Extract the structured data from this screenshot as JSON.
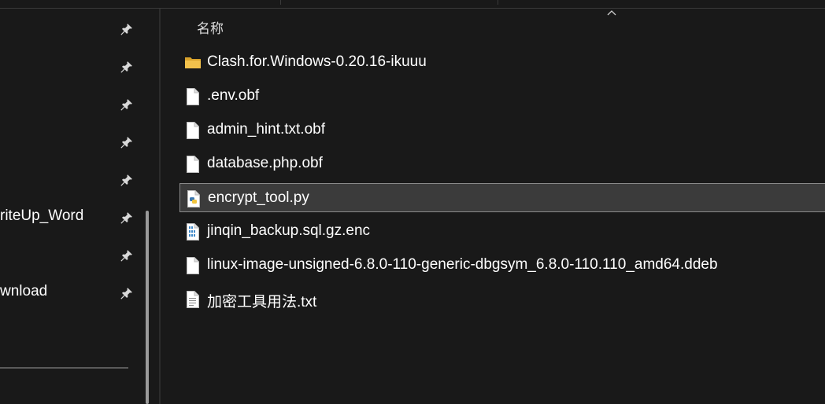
{
  "nav": {
    "items": [
      {
        "label": "",
        "pinned": true
      },
      {
        "label": "",
        "pinned": true
      },
      {
        "label": "",
        "pinned": true
      },
      {
        "label": "",
        "pinned": true
      },
      {
        "label": "",
        "pinned": true
      },
      {
        "label": "riteUp_Word",
        "pinned": true
      },
      {
        "label": "",
        "pinned": true
      },
      {
        "label": "wnload",
        "pinned": true
      }
    ],
    "pin_icon": "pin-icon"
  },
  "list": {
    "column_name": "名称",
    "sort_direction_icon": "sort-ascending-icon",
    "files": [
      {
        "name": "Clash.for.Windows-0.20.16-ikuuu",
        "icon": "folder-icon"
      },
      {
        "name": ".env.obf",
        "icon": "file-icon"
      },
      {
        "name": "admin_hint.txt.obf",
        "icon": "file-icon"
      },
      {
        "name": "database.php.obf",
        "icon": "file-icon"
      },
      {
        "name": "encrypt_tool.py",
        "icon": "python-file-icon",
        "selected": true
      },
      {
        "name": "jinqin_backup.sql.gz.enc",
        "icon": "binary-file-icon"
      },
      {
        "name": "linux-image-unsigned-6.8.0-110-generic-dbgsym_6.8.0-110.110_amd64.ddeb",
        "icon": "file-icon"
      },
      {
        "name": "加密工具用法.txt",
        "icon": "text-file-icon"
      }
    ]
  },
  "colors": {
    "background": "#191919",
    "selection": "#3b3b3b",
    "folder": "#f3c24c"
  }
}
